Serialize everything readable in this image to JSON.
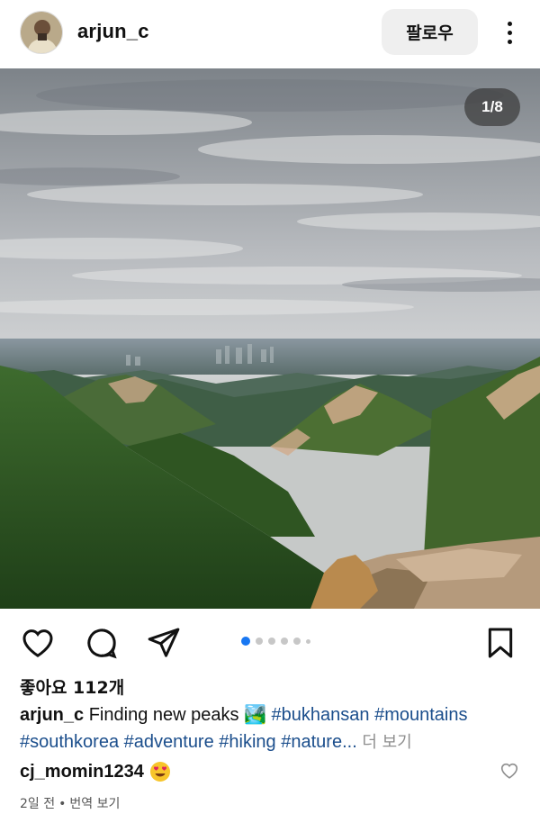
{
  "header": {
    "username": "arjun_c",
    "follow_label": "팔로우",
    "more_icon": "more-vertical-icon"
  },
  "post": {
    "image_counter": "1/8",
    "image_subject": "mountain landscape under cloudy sky",
    "carousel": {
      "total_dots": 6,
      "active_index": 0
    }
  },
  "actions": {
    "like_icon": "heart-icon",
    "comment_icon": "comment-icon",
    "share_icon": "send-icon",
    "save_icon": "bookmark-icon"
  },
  "likes_text": "좋아요 112개",
  "caption": {
    "username": "arjun_c",
    "text": "Finding new peaks",
    "emoji": "🏞️",
    "hashtags": [
      "#bukhansan",
      "#mountains",
      "#southkorea",
      "#adventure",
      "#hiking",
      "#nature"
    ],
    "ellipsis": "...",
    "more_label": "더 보기"
  },
  "comment": {
    "username": "cj_momin1234",
    "emoji": "heart-eyes-emoji"
  },
  "meta": {
    "time": "2일 전",
    "separator": "•",
    "translate_label": "번역 보기"
  },
  "colors": {
    "hashtag": "#1b4e8c",
    "active_dot": "#1877f2",
    "follow_bg": "#efefef"
  }
}
